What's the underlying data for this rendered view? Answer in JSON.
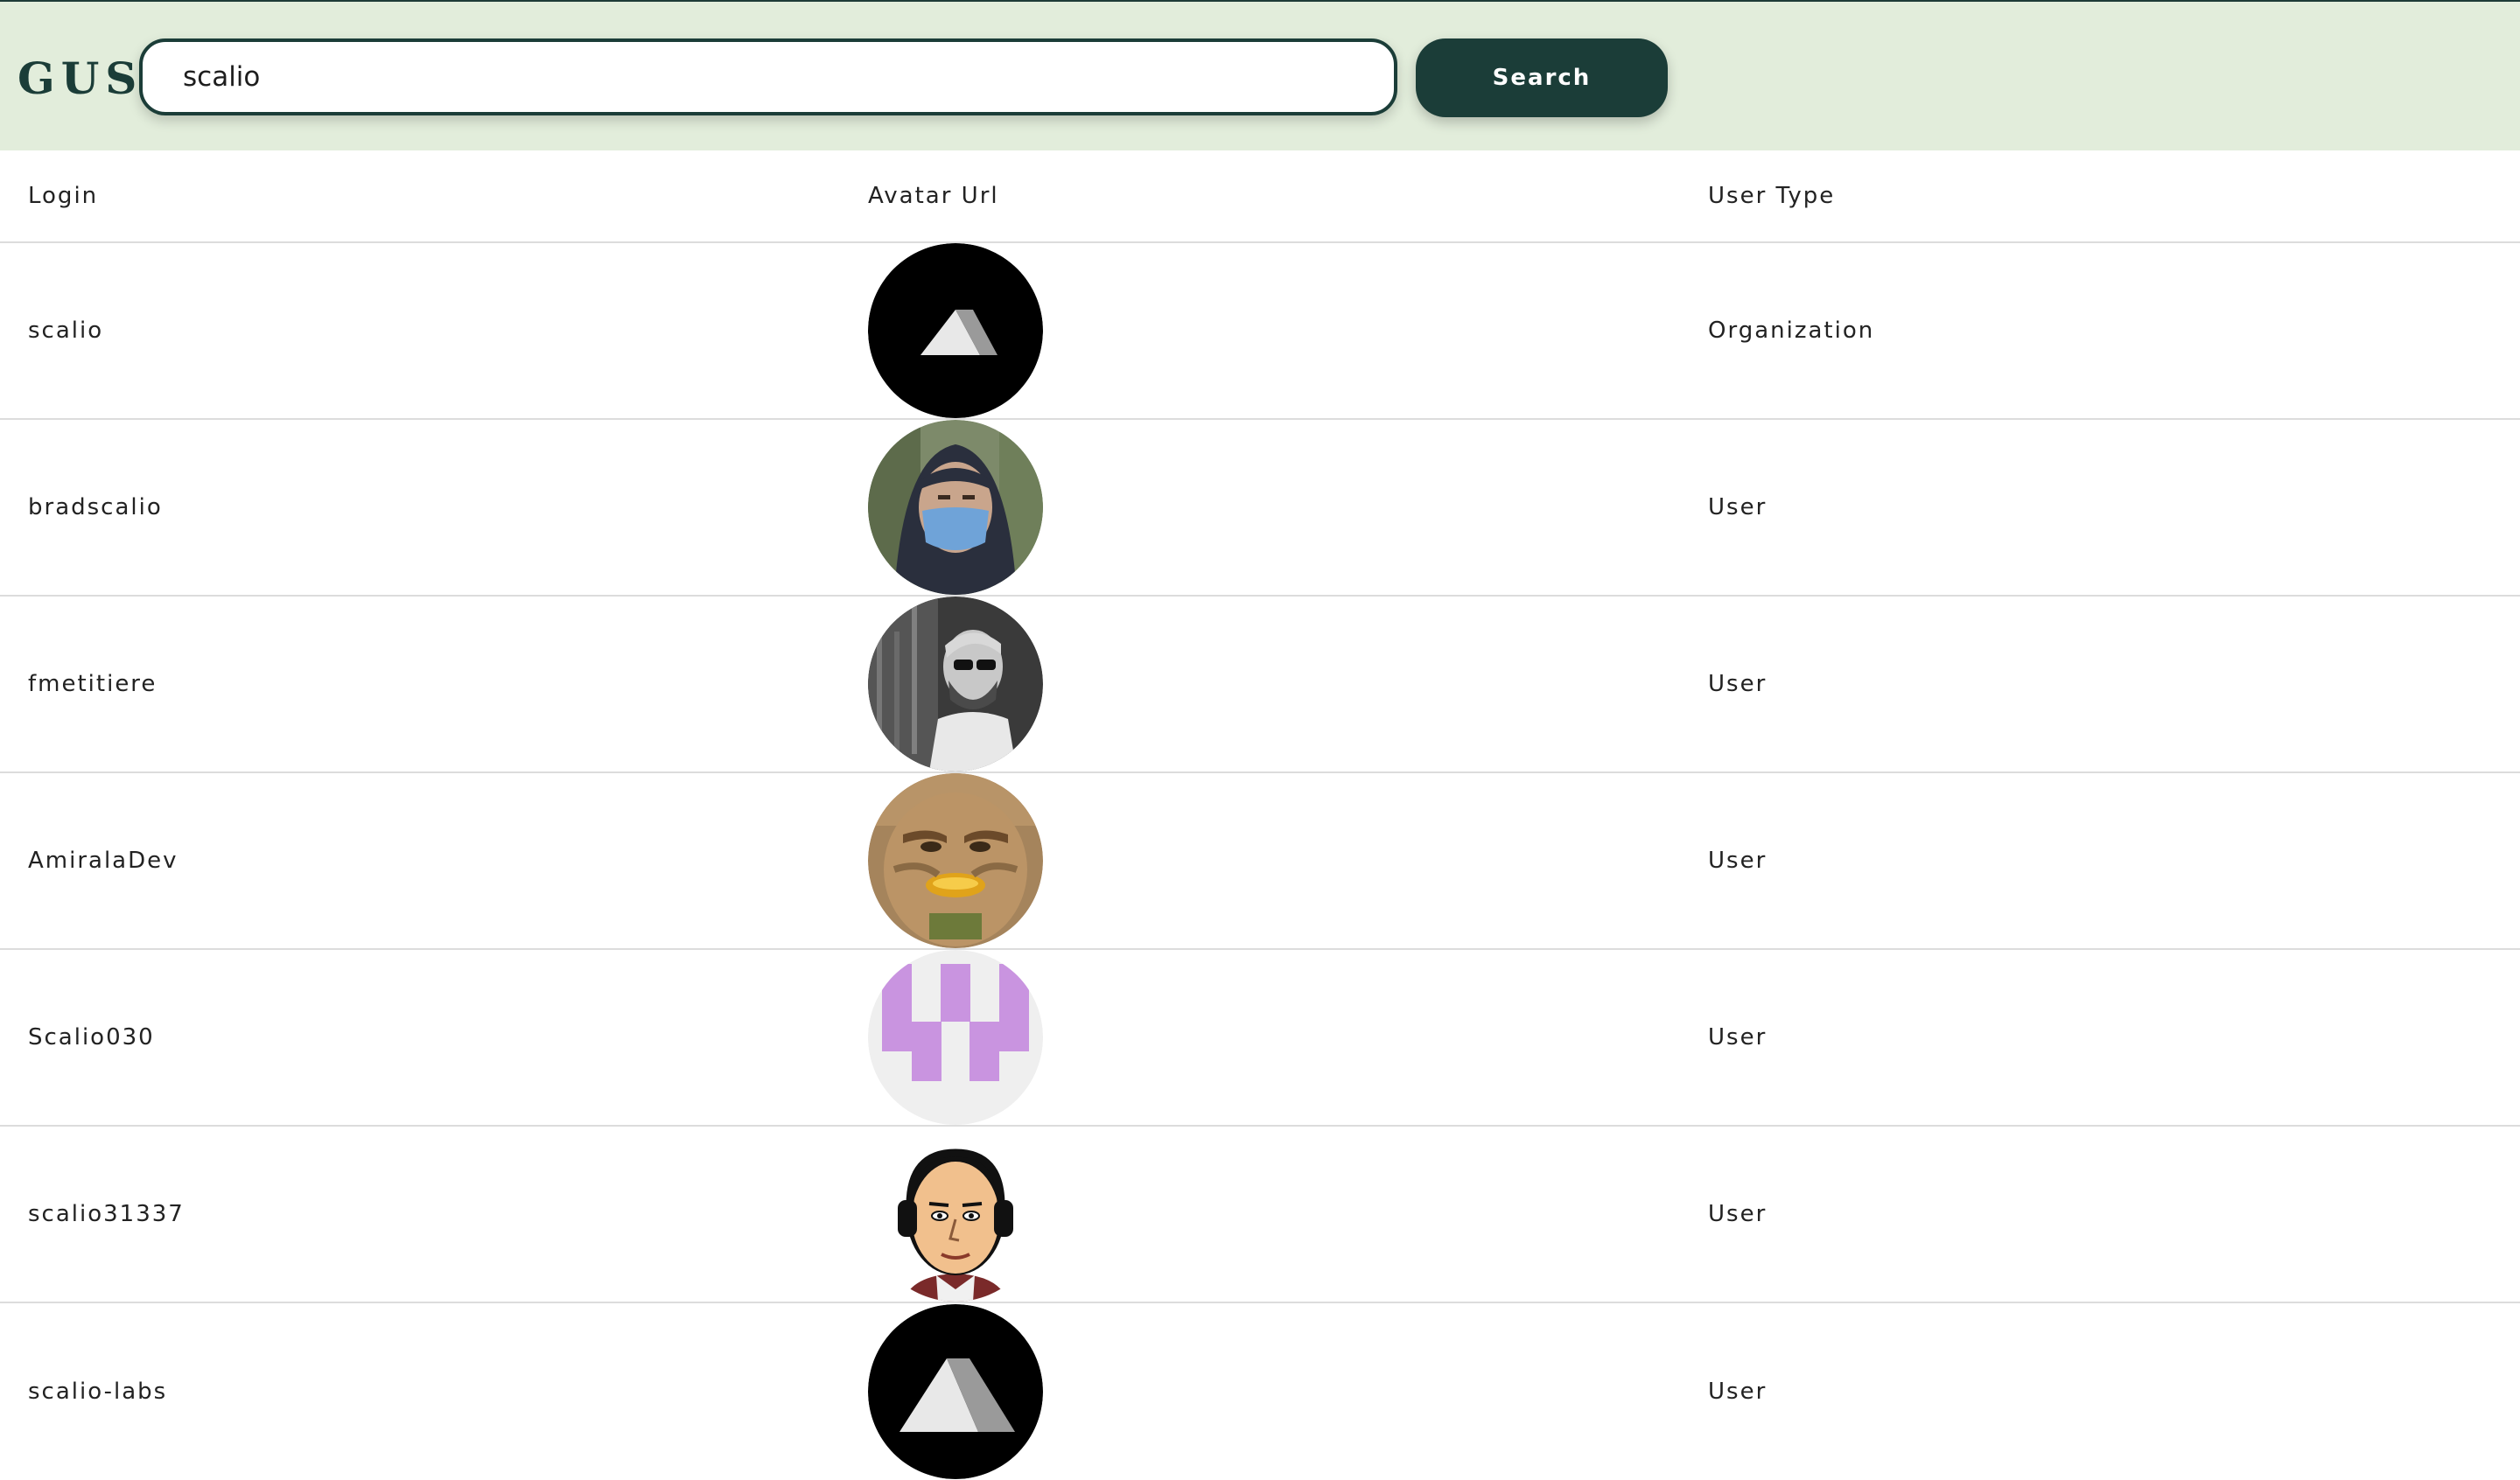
{
  "header": {
    "logo": "GUS",
    "search_value": "scalio",
    "search_button_label": "Search"
  },
  "table": {
    "columns": [
      "Login",
      "Avatar Url",
      "User Type"
    ],
    "rows": [
      {
        "login": "scalio",
        "avatar": "mountain-logo-avatar",
        "type": "Organization"
      },
      {
        "login": "bradscalio",
        "avatar": "masked-person-photo-avatar",
        "type": "User"
      },
      {
        "login": "fmetitiere",
        "avatar": "bearded-man-photo-avatar",
        "type": "User"
      },
      {
        "login": "AmiralaDev",
        "avatar": "golden-face-artwork-avatar",
        "type": "User"
      },
      {
        "login": "Scalio030",
        "avatar": "purple-identicon-avatar",
        "type": "User"
      },
      {
        "login": "scalio31337",
        "avatar": "headphone-cartoon-avatar",
        "type": "User"
      },
      {
        "login": "scalio-labs",
        "avatar": "mountain-logo-avatar",
        "type": "User"
      }
    ]
  },
  "colors": {
    "header_bg": "#e2eddb",
    "accent": "#1b3d38",
    "row_divider": "#dcdcdc"
  }
}
